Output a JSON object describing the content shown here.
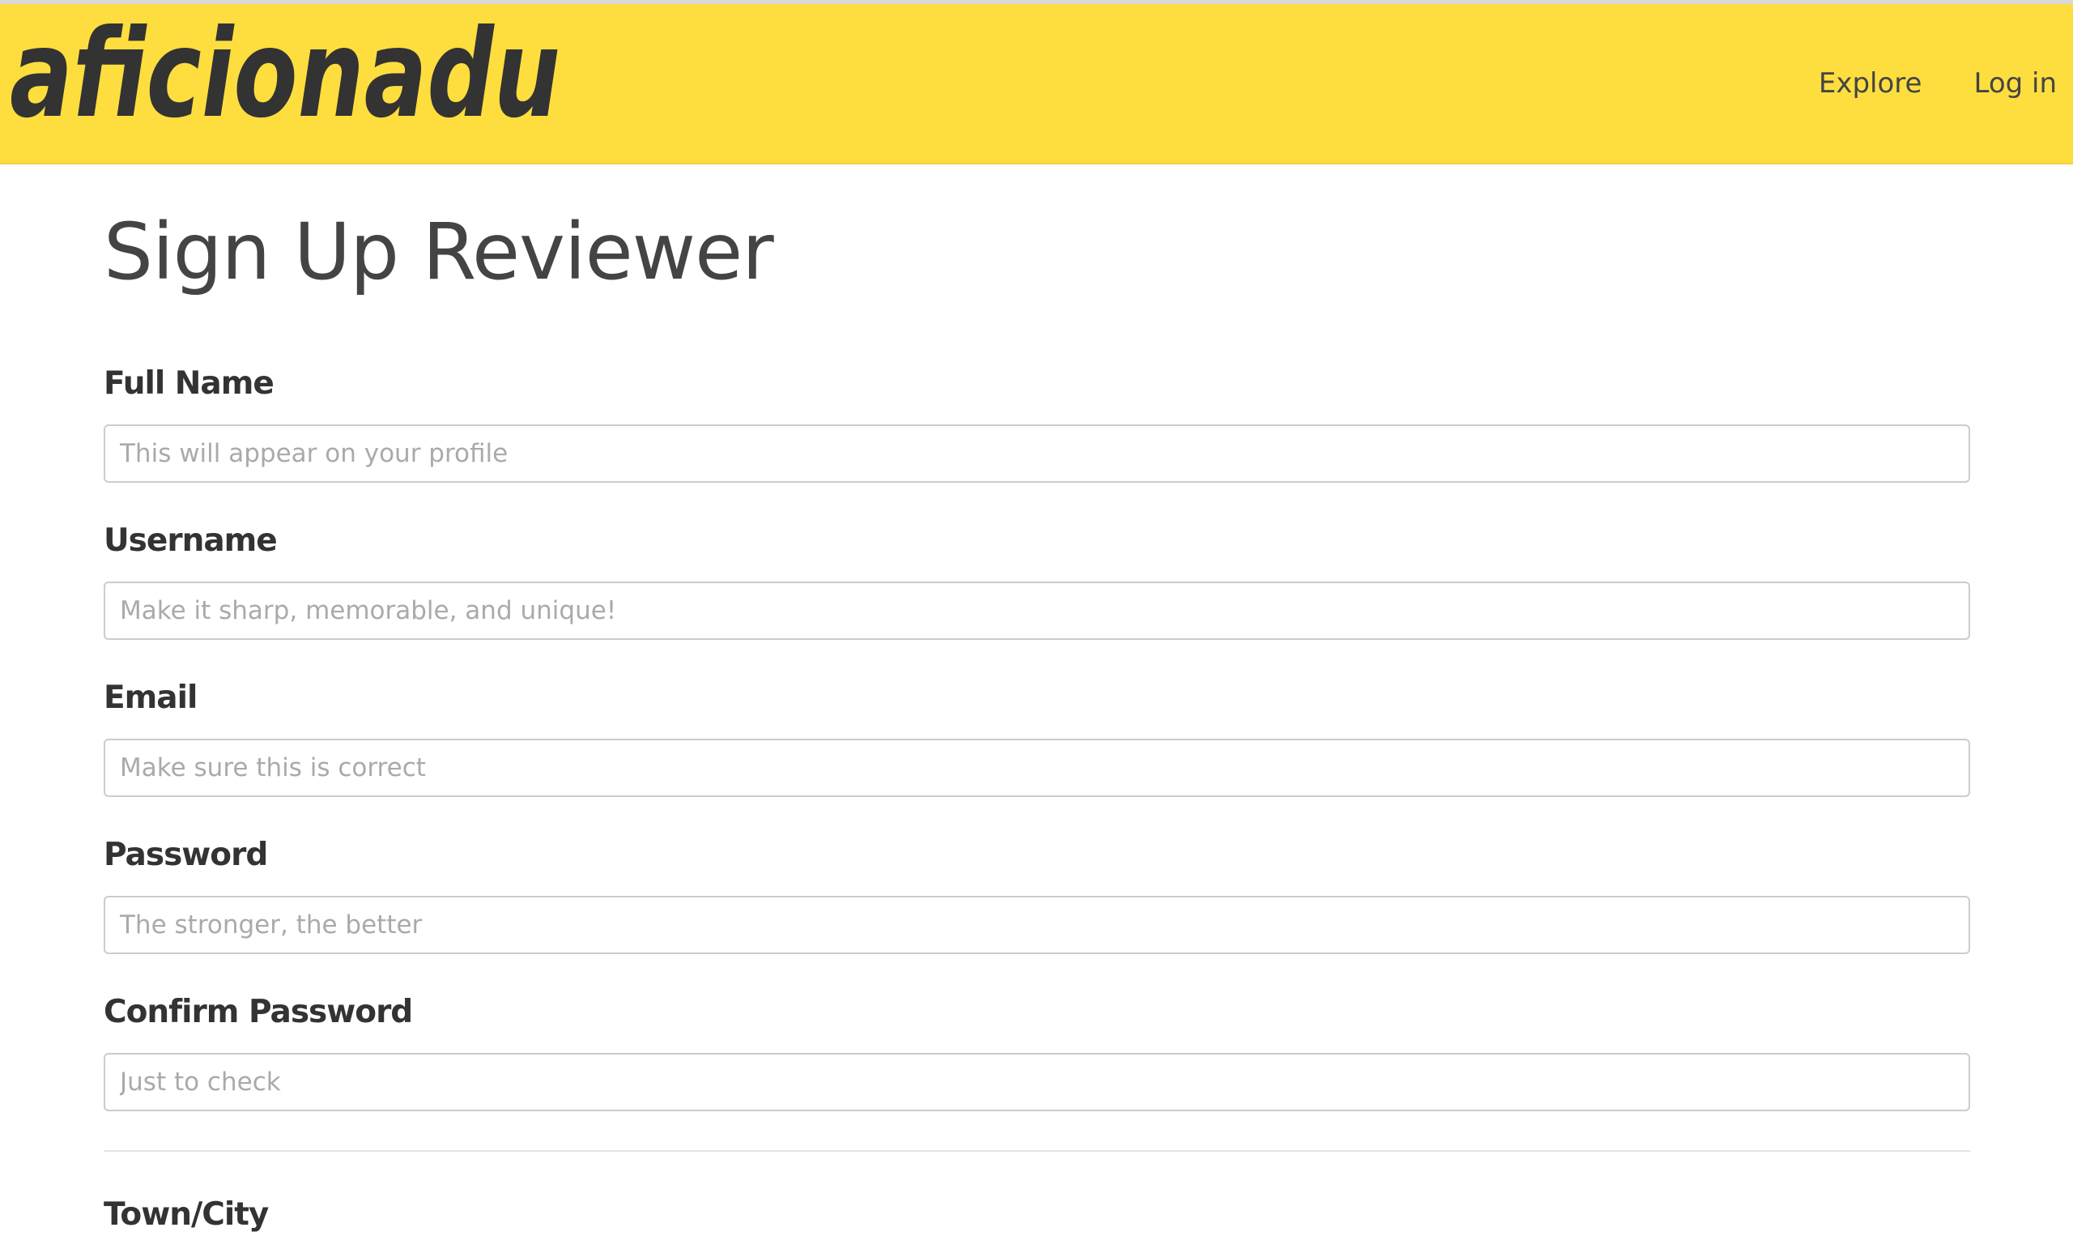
{
  "header": {
    "brand": "aficionadu",
    "nav": [
      {
        "label": "Explore"
      },
      {
        "label": "Log in"
      }
    ],
    "background_color": "#fede3f"
  },
  "page": {
    "title": "Sign Up Reviewer"
  },
  "form": {
    "fields": [
      {
        "label": "Full Name",
        "placeholder": "This will appear on your profile",
        "value": ""
      },
      {
        "label": "Username",
        "placeholder": "Make it sharp, memorable, and unique!",
        "value": ""
      },
      {
        "label": "Email",
        "placeholder": "Make sure this is correct",
        "value": ""
      },
      {
        "label": "Password",
        "placeholder": "The stronger, the better",
        "value": ""
      },
      {
        "label": "Confirm Password",
        "placeholder": "Just to check",
        "value": ""
      }
    ],
    "location_label": "Town/City"
  }
}
